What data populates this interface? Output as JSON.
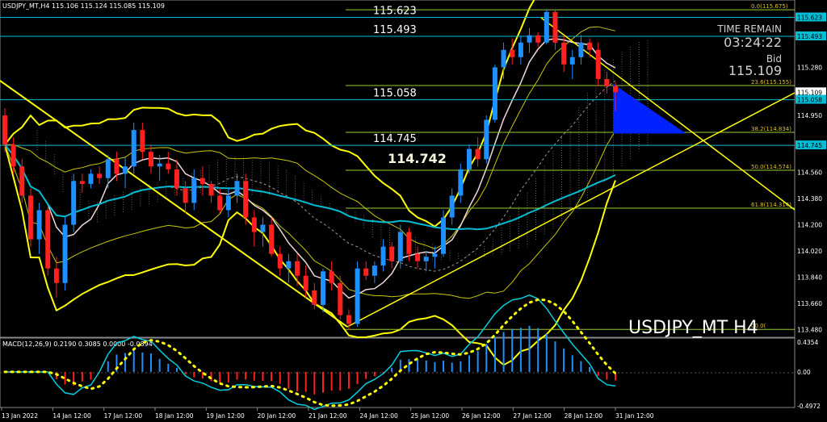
{
  "header": {
    "symbol_info": "USDJPY_MT,H4  115.106 115.124 115.085 115.109"
  },
  "watermark": "USDJPY_MT H4",
  "timer": {
    "label": "TIME REMAIN",
    "value": "03:24:22",
    "bid_label": "Bid",
    "bid_value": "115.109"
  },
  "price_levels": [
    {
      "label": "115.623",
      "value": 115.623,
      "color": "#00bcd4"
    },
    {
      "label": "115.493",
      "value": 115.493,
      "color": "#00bcd4"
    },
    {
      "label": "115.058",
      "value": 115.058,
      "color": "#00bcd4"
    },
    {
      "label": "114.745",
      "value": 114.745,
      "color": "#00bcd4"
    }
  ],
  "highlight_price": "114.742",
  "fib_labels": [
    {
      "label": "0.0(115.675)",
      "value": 115.675
    },
    {
      "label": "23.6(115.155)",
      "value": 115.155
    },
    {
      "label": "38.2(114.834)",
      "value": 114.834
    },
    {
      "label": "50.0(114.574)",
      "value": 114.574
    },
    {
      "label": "61.8(114.314)",
      "value": 114.314
    },
    {
      "label": "00.0(",
      "value": 113.482
    }
  ],
  "price_axis": [
    "115.623",
    "115.493",
    "115.280",
    "115.109",
    "115.058",
    "114.950",
    "114.745",
    "114.560",
    "114.380",
    "114.200",
    "114.020",
    "113.840",
    "113.660",
    "113.480"
  ],
  "price_axis_values": [
    115.623,
    115.493,
    115.28,
    115.109,
    115.058,
    114.95,
    114.745,
    114.56,
    114.38,
    114.2,
    114.02,
    113.84,
    113.66,
    113.48
  ],
  "price_axis_highlights": {
    "115.623": "#00bcd4",
    "115.493": "#00bcd4",
    "115.109": "#ffffff",
    "115.058": "#00bcd4",
    "114.745": "#00bcd4"
  },
  "macd": {
    "label": "MACD(12,26,9) 0.2190 0.3085 0.0000 -0.0894",
    "axis": [
      "0.4354",
      "0.00",
      "-0.4972"
    ],
    "axis_values": [
      0.4354,
      0.0,
      -0.4972
    ]
  },
  "time_axis": [
    "13 Jan 2022",
    "14 Jan 12:00",
    "17 Jan 12:00",
    "18 Jan 12:00",
    "19 Jan 12:00",
    "20 Jan 12:00",
    "21 Jan 12:00",
    "24 Jan 12:00",
    "25 Jan 12:00",
    "26 Jan 12:00",
    "27 Jan 12:00",
    "28 Jan 12:00",
    "31 Jan 12:00"
  ],
  "colors": {
    "bull": "#1e90ff",
    "bear": "#ff2020",
    "level": "#00bcd4",
    "fib": "#9acd32",
    "band": "#ffff00",
    "ma": "#00bcd4",
    "macd_line": "#00d0e0",
    "macd_signal": "#ffff00"
  },
  "chart_data": {
    "type": "candlestick",
    "symbol": "USDJPY_MT",
    "timeframe": "H4",
    "ylim": [
      113.45,
      115.72
    ],
    "candles": [
      [
        114.95,
        115.0,
        114.7,
        114.75
      ],
      [
        114.75,
        114.8,
        114.55,
        114.6
      ],
      [
        114.6,
        114.65,
        114.35,
        114.4
      ],
      [
        114.4,
        114.45,
        114.05,
        114.1
      ],
      [
        114.1,
        114.35,
        114.0,
        114.3
      ],
      [
        114.3,
        114.32,
        113.85,
        113.9
      ],
      [
        113.9,
        113.98,
        113.7,
        113.8
      ],
      [
        113.8,
        114.25,
        113.75,
        114.2
      ],
      [
        114.2,
        114.55,
        114.15,
        114.5
      ],
      [
        114.5,
        114.55,
        114.42,
        114.48
      ],
      [
        114.48,
        114.58,
        114.45,
        114.55
      ],
      [
        114.55,
        114.6,
        114.48,
        114.52
      ],
      [
        114.52,
        114.68,
        114.45,
        114.65
      ],
      [
        114.65,
        114.7,
        114.5,
        114.55
      ],
      [
        114.55,
        114.66,
        114.45,
        114.6
      ],
      [
        114.6,
        114.9,
        114.55,
        114.85
      ],
      [
        114.85,
        114.9,
        114.65,
        114.7
      ],
      [
        114.7,
        114.75,
        114.55,
        114.6
      ],
      [
        114.6,
        114.68,
        114.5,
        114.62
      ],
      [
        114.62,
        114.7,
        114.55,
        114.58
      ],
      [
        114.58,
        114.65,
        114.4,
        114.45
      ],
      [
        114.45,
        114.5,
        114.28,
        114.35
      ],
      [
        114.35,
        114.58,
        114.3,
        114.52
      ],
      [
        114.52,
        114.6,
        114.4,
        114.48
      ],
      [
        114.48,
        114.5,
        114.35,
        114.4
      ],
      [
        114.4,
        114.45,
        114.28,
        114.3
      ],
      [
        114.3,
        114.45,
        114.25,
        114.4
      ],
      [
        114.4,
        114.55,
        114.35,
        114.5
      ],
      [
        114.5,
        114.55,
        114.2,
        114.25
      ],
      [
        114.25,
        114.3,
        114.05,
        114.15
      ],
      [
        114.15,
        114.25,
        114.05,
        114.2
      ],
      [
        114.2,
        114.25,
        113.98,
        114.0
      ],
      [
        114.0,
        114.05,
        113.85,
        113.9
      ],
      [
        113.9,
        114.0,
        113.8,
        113.95
      ],
      [
        113.95,
        114.0,
        113.78,
        113.85
      ],
      [
        113.85,
        113.92,
        113.7,
        113.75
      ],
      [
        113.75,
        113.8,
        113.62,
        113.65
      ],
      [
        113.65,
        113.9,
        113.6,
        113.88
      ],
      [
        113.88,
        113.95,
        113.75,
        113.8
      ],
      [
        113.8,
        113.85,
        113.55,
        113.58
      ],
      [
        113.58,
        113.62,
        113.48,
        113.52
      ],
      [
        113.52,
        113.95,
        113.5,
        113.9
      ],
      [
        113.9,
        113.95,
        113.82,
        113.85
      ],
      [
        113.85,
        113.95,
        113.8,
        113.92
      ],
      [
        113.92,
        114.1,
        113.88,
        114.05
      ],
      [
        114.05,
        114.08,
        113.9,
        113.95
      ],
      [
        113.95,
        114.2,
        113.9,
        114.15
      ],
      [
        114.15,
        114.18,
        113.95,
        114.0
      ],
      [
        114.0,
        114.05,
        113.9,
        113.95
      ],
      [
        113.95,
        114.02,
        113.88,
        113.98
      ],
      [
        113.98,
        114.05,
        113.9,
        114.0
      ],
      [
        114.0,
        114.3,
        113.98,
        114.25
      ],
      [
        114.25,
        114.45,
        114.2,
        114.4
      ],
      [
        114.4,
        114.62,
        114.35,
        114.58
      ],
      [
        114.58,
        114.75,
        114.55,
        114.72
      ],
      [
        114.72,
        114.8,
        114.6,
        114.65
      ],
      [
        114.65,
        114.95,
        114.62,
        114.92
      ],
      [
        114.92,
        115.3,
        114.9,
        115.28
      ],
      [
        115.28,
        115.45,
        115.2,
        115.4
      ],
      [
        115.4,
        115.48,
        115.3,
        115.35
      ],
      [
        115.35,
        115.5,
        115.3,
        115.45
      ],
      [
        115.45,
        115.55,
        115.38,
        115.5
      ],
      [
        115.5,
        115.52,
        115.42,
        115.45
      ],
      [
        115.45,
        115.68,
        115.44,
        115.66
      ],
      [
        115.66,
        115.68,
        115.4,
        115.45
      ],
      [
        115.45,
        115.5,
        115.25,
        115.3
      ],
      [
        115.3,
        115.4,
        115.2,
        115.35
      ],
      [
        115.35,
        115.5,
        115.3,
        115.45
      ],
      [
        115.45,
        115.48,
        115.35,
        115.4
      ],
      [
        115.4,
        115.45,
        115.15,
        115.2
      ],
      [
        115.2,
        115.25,
        115.1,
        115.15
      ],
      [
        115.15,
        115.18,
        114.98,
        115.109
      ]
    ]
  }
}
